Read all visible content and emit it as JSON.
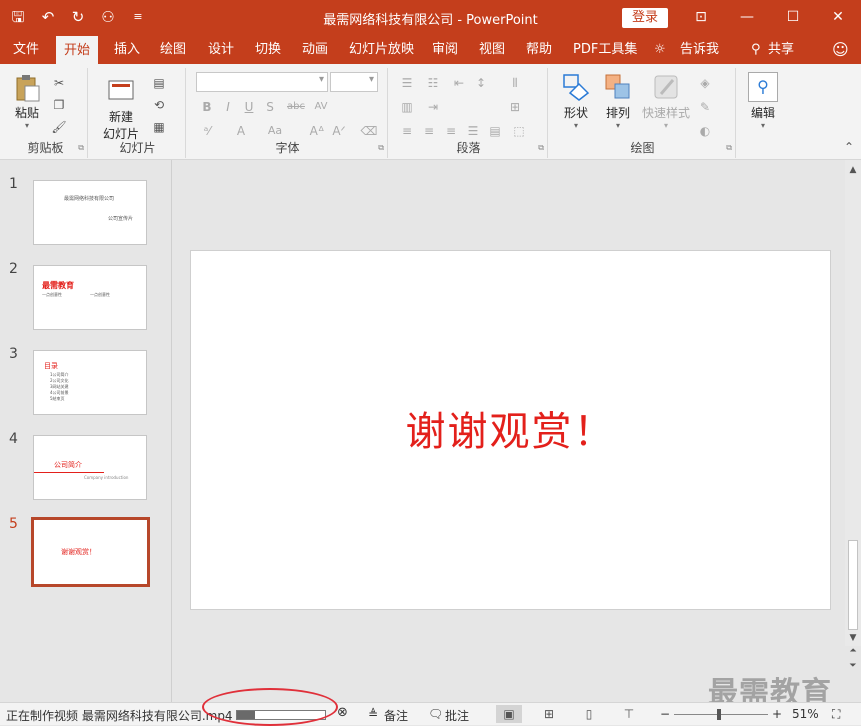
{
  "window": {
    "title": "最需网络科技有限公司 - PowerPoint",
    "login_label": "登录",
    "ribbon_display_icon": "ribbon-display-options-icon",
    "minimize_icon": "minimize-icon",
    "maximize_icon": "maximize-icon",
    "close_icon": "close-icon"
  },
  "qat": {
    "items": [
      "save-icon",
      "undo-icon",
      "redo-icon",
      "presentation-icon",
      "customize-icon"
    ]
  },
  "tabs": [
    {
      "label": "文件"
    },
    {
      "label": "开始",
      "active": true
    },
    {
      "label": "插入"
    },
    {
      "label": "绘图"
    },
    {
      "label": "设计"
    },
    {
      "label": "切换"
    },
    {
      "label": "动画"
    },
    {
      "label": "幻灯片放映"
    },
    {
      "label": "审阅"
    },
    {
      "label": "视图"
    },
    {
      "label": "帮助"
    },
    {
      "label": "PDF工具集"
    },
    {
      "label": "告诉我"
    },
    {
      "label": "共享"
    }
  ],
  "ribbon": {
    "clipboard": {
      "label": "剪贴板",
      "paste": "粘贴"
    },
    "slides": {
      "label": "幻灯片",
      "new_slide_line1": "新建",
      "new_slide_line2": "幻灯片"
    },
    "font": {
      "label": "字体",
      "bold": "B",
      "italic": "I",
      "underline": "U",
      "shadow": "S",
      "strike": "abc",
      "spacing": "AV",
      "case": "Aa"
    },
    "paragraph": {
      "label": "段落"
    },
    "drawing": {
      "label": "绘图",
      "shapes": "形状",
      "arrange": "排列",
      "quick_styles": "快速样式"
    },
    "editing": {
      "label": "编辑"
    }
  },
  "slides": [
    {
      "num": "1",
      "title": "最需网络科技有限公司",
      "sub": "公司宣传片"
    },
    {
      "num": "2",
      "title": "最需教育",
      "left": "一点创意性",
      "right": "一点创意性"
    },
    {
      "num": "3",
      "title": "目录",
      "items": [
        "1公司简介",
        "2公司文化",
        "3网站关建",
        "4公司前景",
        "5结束页"
      ]
    },
    {
      "num": "4",
      "title": "公司简介",
      "sub": "Company introduction"
    },
    {
      "num": "5",
      "title": "谢谢观赏！",
      "current": true
    }
  ],
  "main_slide": {
    "text": "谢谢观赏！"
  },
  "status": {
    "video_status": "正在制作视频 最需网络科技有限公司.mp4",
    "progress": 0.2,
    "notes_label": "备注",
    "comments_label": "批注",
    "zoom_text": "51%"
  },
  "watermark": "最需教育",
  "colors": {
    "accent": "#c43e1c",
    "slide_text": "#e3201b",
    "annotation": "#e0303a"
  }
}
